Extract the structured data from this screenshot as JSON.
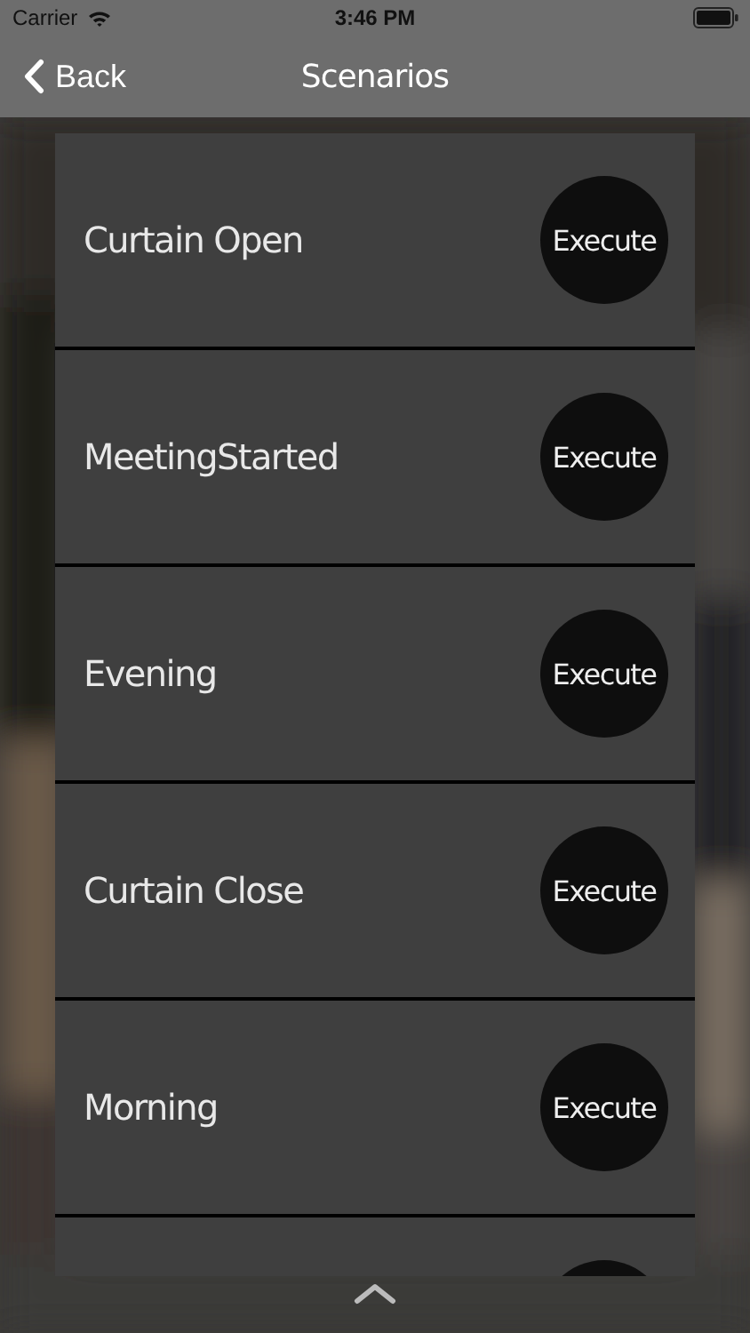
{
  "status_bar": {
    "carrier": "Carrier",
    "time": "3:46 PM"
  },
  "nav_bar": {
    "back": "Back",
    "title": "Scenarios"
  },
  "scenarios": [
    {
      "name": "Curtain Open",
      "action": "Execute"
    },
    {
      "name": "MeetingStarted",
      "action": "Execute"
    },
    {
      "name": "Evening",
      "action": "Execute"
    },
    {
      "name": "Curtain Close",
      "action": "Execute"
    },
    {
      "name": "Morning",
      "action": "Execute"
    }
  ]
}
